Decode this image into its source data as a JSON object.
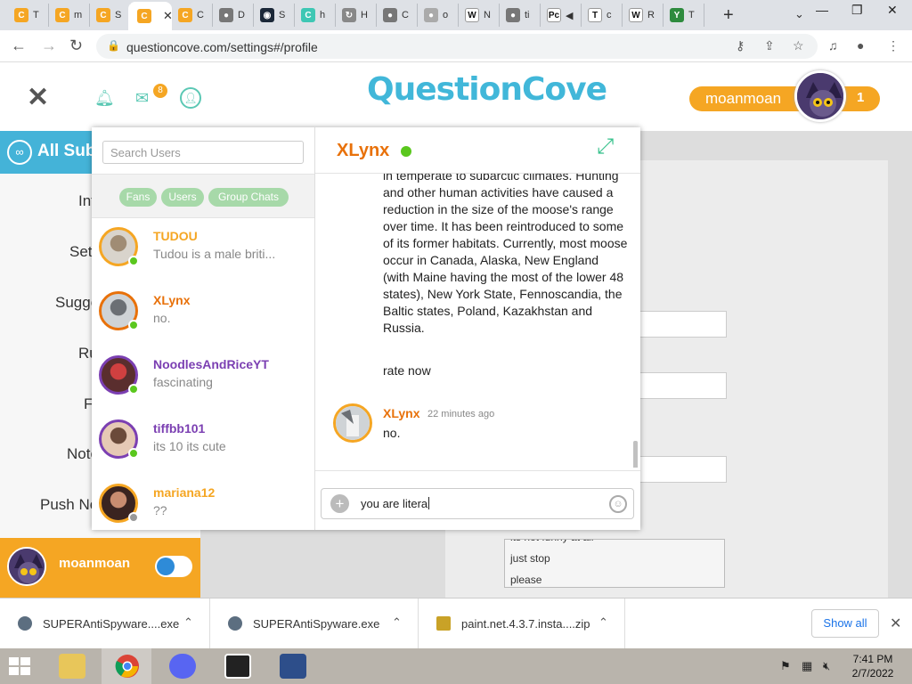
{
  "browser": {
    "tabs": [
      {
        "favicon": "C",
        "color": "#f5a623",
        "title": "T"
      },
      {
        "favicon": "C",
        "color": "#f5a623",
        "title": "m"
      },
      {
        "favicon": "C",
        "color": "#f5a623",
        "title": "S"
      },
      {
        "favicon": "C",
        "color": "#f5a623",
        "title": "",
        "active": true
      },
      {
        "favicon": "C",
        "color": "#f5a623",
        "title": "C"
      },
      {
        "favicon": "●",
        "color": "#777",
        "title": "D"
      },
      {
        "favicon": "◉",
        "color": "#1b2838",
        "title": "S"
      },
      {
        "favicon": "C",
        "color": "#3ec7b4",
        "title": "h"
      },
      {
        "favicon": "↻",
        "color": "#888",
        "title": "H"
      },
      {
        "favicon": "●",
        "color": "#777",
        "title": "C"
      },
      {
        "favicon": "●",
        "color": "#aaa",
        "title": "o"
      },
      {
        "favicon": "W",
        "color": "#fff",
        "title": "N"
      },
      {
        "favicon": "●",
        "color": "#777",
        "title": "ti"
      },
      {
        "favicon": "Pc",
        "color": "#fff",
        "title": "◀"
      },
      {
        "favicon": "T",
        "color": "#fff",
        "title": "c"
      },
      {
        "favicon": "W",
        "color": "#fff",
        "title": "R"
      },
      {
        "favicon": "Y",
        "color": "#2e8b3e",
        "title": "T"
      }
    ],
    "active_tab_close": "✕",
    "new_tab": "+",
    "url": "questioncove.com/settings#/profile"
  },
  "site": {
    "logo": "QuestionCove",
    "mail_badge": "8",
    "username": "moanmoan",
    "score": "1"
  },
  "sidebar": {
    "header": "All Sub",
    "links": [
      "Int",
      "Set",
      "Sugge",
      "Ru",
      "FA",
      "Note",
      "Push No"
    ],
    "username": "moanmoan"
  },
  "bio": [
    "its not funny at all",
    "just stop",
    "please"
  ],
  "chat": {
    "search_placeholder": "Search Users",
    "filters": [
      "Fans",
      "Users",
      "Group Chats"
    ],
    "contacts": [
      {
        "name": "TUDOU",
        "msg": "Tudou is a male briti...",
        "name_color": "#f5a623",
        "status": "online"
      },
      {
        "name": "XLynx",
        "msg": "no.",
        "name_color": "#e8710a",
        "status": "online"
      },
      {
        "name": "NoodlesAndRiceYT",
        "msg": "fascinating",
        "name_color": "#7b3fb2",
        "status": "online"
      },
      {
        "name": "tiffbb101",
        "msg": "its 10 its cute",
        "name_color": "#7b3fb2",
        "status": "online"
      },
      {
        "name": "mariana12",
        "msg": "??",
        "name_color": "#f5a623",
        "status": "offline"
      }
    ],
    "peer": "XLynx",
    "long_message": "in temperate to subarctic climates. Hunting and other human activities have caused a reduction in the size of the moose's range over time. It has been reintroduced to some of its former habitats. Currently, most moose occur in Canada, Alaska, New England (with Maine having the most of the lower 48 states), New York State, Fennoscandia, the Baltic states, Poland, Kazakhstan and Russia.",
    "rate_message": "rate now",
    "last_sender": "XLynx",
    "last_time": "22 minutes ago",
    "last_message": "no.",
    "compose_text": "you are litera"
  },
  "downloads": {
    "items": [
      "SUPERAntiSpyware....exe",
      "SUPERAntiSpyware.exe",
      "paint.net.4.3.7.insta....zip"
    ],
    "show_all": "Show all"
  },
  "taskbar": {
    "time": "7:41 PM",
    "date": "2/7/2022"
  }
}
